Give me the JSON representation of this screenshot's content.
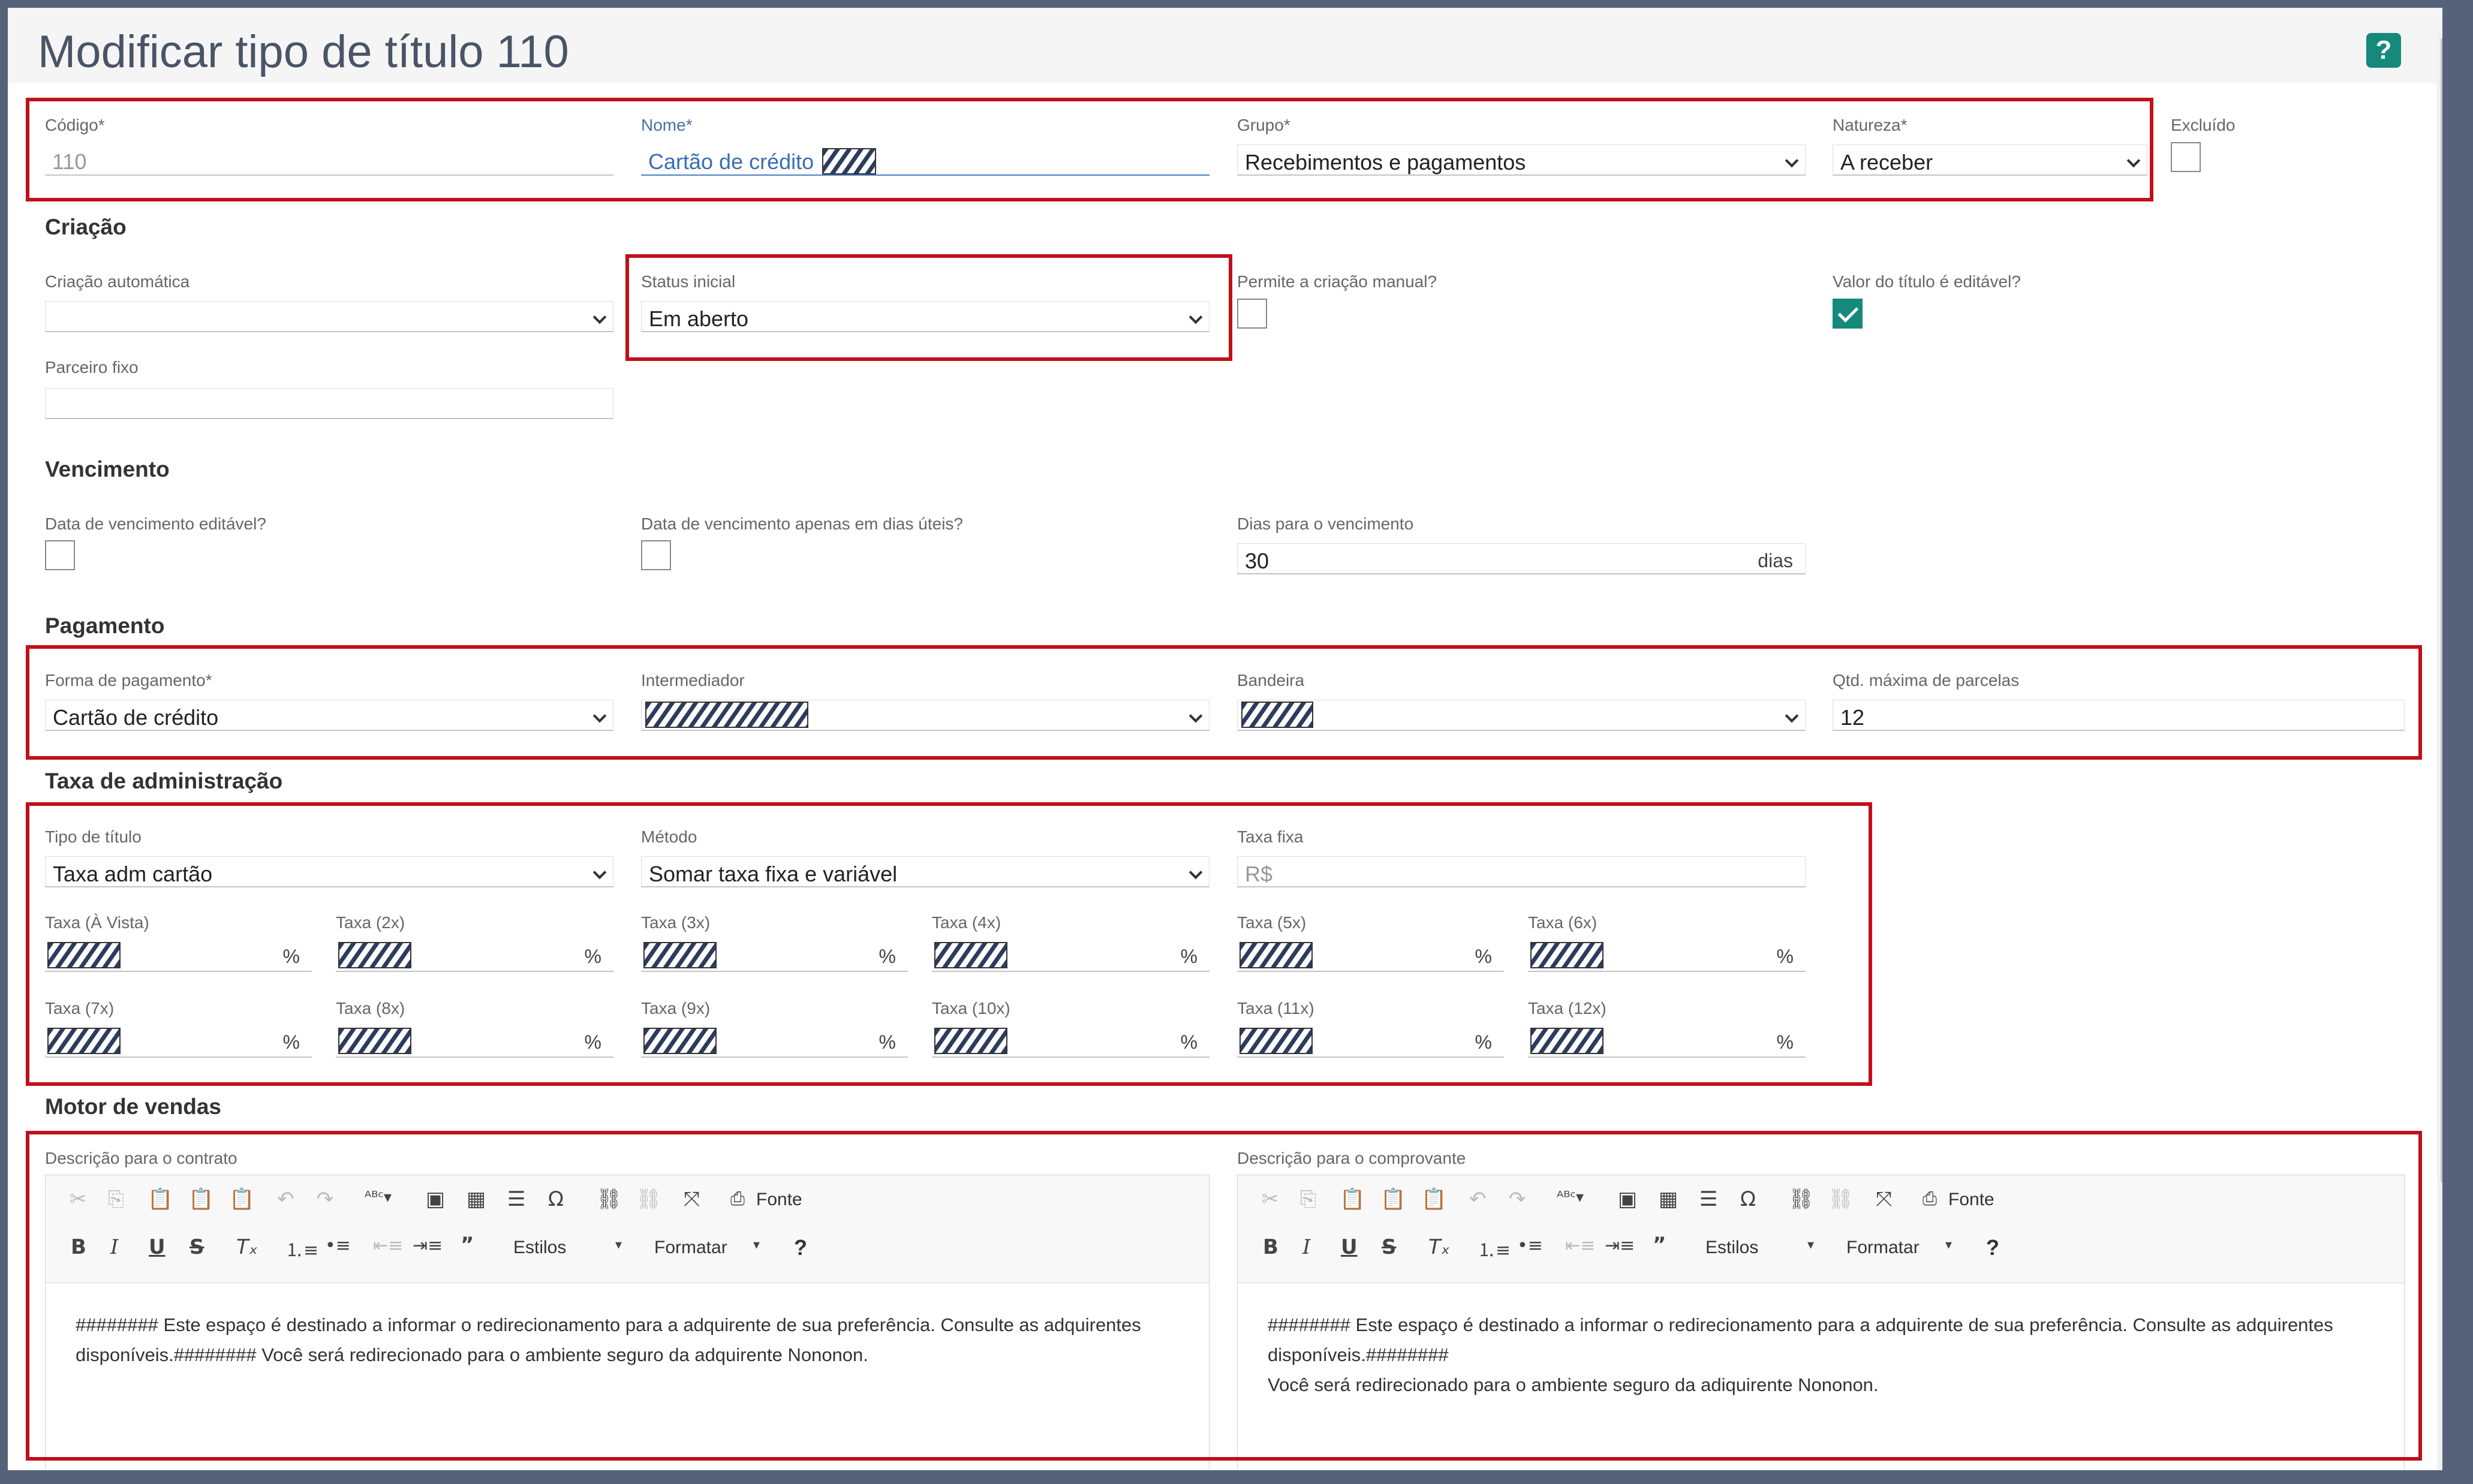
{
  "header": {
    "title": "Modificar tipo de título 110",
    "help_label": "?"
  },
  "top_row": {
    "codigo": {
      "label": "Código*",
      "value": "110"
    },
    "nome": {
      "label": "Nome*",
      "value": "Cartão de crédito"
    },
    "grupo": {
      "label": "Grupo*",
      "value": "Recebimentos e pagamentos"
    },
    "natureza": {
      "label": "Natureza*",
      "value": "A receber"
    },
    "excluido": {
      "label": "Excluído",
      "checked": false
    }
  },
  "criacao": {
    "title": "Criação",
    "criacao_automatica": {
      "label": "Criação automática",
      "value": ""
    },
    "status_inicial": {
      "label": "Status inicial",
      "value": "Em aberto"
    },
    "permite_manual": {
      "label": "Permite a criação manual?",
      "checked": false
    },
    "valor_editavel": {
      "label": "Valor do título é editável?",
      "checked": true
    },
    "parceiro_fixo": {
      "label": "Parceiro fixo",
      "value": ""
    }
  },
  "vencimento": {
    "title": "Vencimento",
    "data_editavel": {
      "label": "Data de vencimento editável?",
      "checked": false
    },
    "dias_uteis": {
      "label": "Data de vencimento apenas em dias úteis?",
      "checked": false
    },
    "dias": {
      "label": "Dias para o vencimento",
      "value": "30",
      "unit": "dias"
    }
  },
  "pagamento": {
    "title": "Pagamento",
    "forma": {
      "label": "Forma de pagamento*",
      "value": "Cartão de crédito"
    },
    "intermediador": {
      "label": "Intermediador"
    },
    "bandeira": {
      "label": "Bandeira"
    },
    "parcelas": {
      "label": "Qtd. máxima de parcelas",
      "value": "12"
    }
  },
  "taxa": {
    "title": "Taxa de administração",
    "tipo": {
      "label": "Tipo de título",
      "value": "Taxa adm cartão"
    },
    "metodo": {
      "label": "Método",
      "value": "Somar taxa fixa e variável"
    },
    "fixa": {
      "label": "Taxa fixa",
      "value": "R$"
    },
    "percent_unit": "%",
    "rates": [
      "Taxa (À Vista)",
      "Taxa (2x)",
      "Taxa (3x)",
      "Taxa (4x)",
      "Taxa (5x)",
      "Taxa (6x)",
      "Taxa (7x)",
      "Taxa (8x)",
      "Taxa (9x)",
      "Taxa (10x)",
      "Taxa (11x)",
      "Taxa (12x)"
    ]
  },
  "motor": {
    "title": "Motor de vendas",
    "toolbar": {
      "fonte": "Fonte",
      "estilos": "Estilos",
      "formatar": "Formatar",
      "help": "?"
    },
    "contrato": {
      "label": "Descrição para o contrato",
      "line1": "######## Este espaço é destinado a informar o redirecionamento para a adquirente de sua preferência. Consulte as adquirentes",
      "line2": "disponíveis.######## Você será redirecionado para o ambiente seguro da adquirente Nononon."
    },
    "comprovante": {
      "label": "Descrição para o comprovante",
      "line1": "######## Este espaço é destinado a informar o redirecionamento para a adquirente de sua preferência. Consulte as adquirentes",
      "line2": "disponíveis.########",
      "line3": "Você será redirecionado para o ambiente seguro da adiquirente Nononon."
    }
  },
  "colors": {
    "accent": "#15897b",
    "highlight": "#c0101a",
    "title": "#4a5467"
  }
}
